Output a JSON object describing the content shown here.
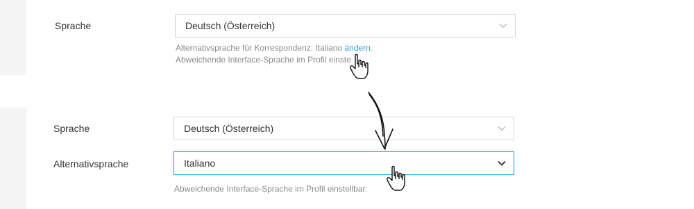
{
  "top_section": {
    "language_label": "Sprache",
    "language_value": "Deutsch (Österreich)",
    "alt_language_text": "Alternativsprache für Korrespondenz: Italiano",
    "change_link": "ändern",
    "change_link_suffix": ".",
    "interface_hint_visible": "Abweichende Interface-Sprache im Profil einste"
  },
  "bottom_section": {
    "language_label": "Sprache",
    "language_value": "Deutsch (Österreich)",
    "alt_language_label": "Alternativsprache",
    "alt_language_value": "Italiano",
    "interface_hint": "Abweichende Interface-Sprache im Profil einstellbar."
  },
  "icons": {
    "dropdown": "chevron-down-icon",
    "cursor": "hand-pointer-icon",
    "arrow": "hand-drawn-arrow-icon"
  },
  "colors": {
    "link": "#2a9fd6",
    "focus_border": "#33a9d8",
    "gutter": "#f4f4f4",
    "hint_text": "#8a8a8a"
  }
}
